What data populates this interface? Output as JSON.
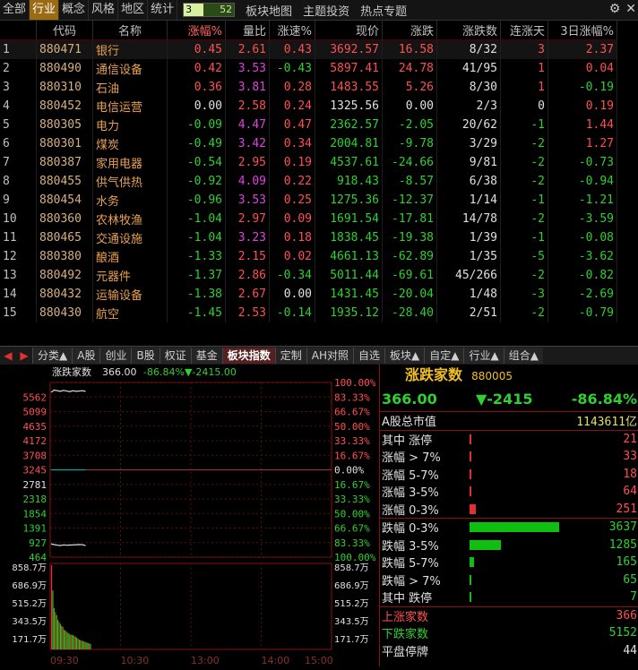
{
  "top_tabs": [
    "全部",
    "行业",
    "概念",
    "风格",
    "地区",
    "统计"
  ],
  "active_top_tab": "行业",
  "pager": {
    "current": "3",
    "total": "52"
  },
  "top_links": [
    "板块地图",
    "主题投资",
    "热点专题"
  ],
  "columns": [
    "",
    "代码",
    "名称",
    "涨幅%",
    "量比",
    "涨速%",
    "现价",
    "涨跌",
    "涨跌数",
    "连涨天",
    "3日涨幅%"
  ],
  "rows": [
    {
      "idx": "1",
      "code": "880471",
      "name": "银行",
      "pct": "0.45",
      "vr": "2.61",
      "spd": "0.43",
      "price": "3692.57",
      "chg": "16.58",
      "ud": "8/32",
      "days": "3",
      "d3": "2.37",
      "pc": "red",
      "vc": "red",
      "sc": "red",
      "dc": "red",
      "d3c": "red"
    },
    {
      "idx": "2",
      "code": "880490",
      "name": "通信设备",
      "pct": "0.42",
      "vr": "3.53",
      "spd": "-0.43",
      "price": "5897.41",
      "chg": "24.78",
      "ud": "41/95",
      "days": "1",
      "d3": "0.04",
      "pc": "red",
      "vc": "purple",
      "sc": "green",
      "dc": "red",
      "d3c": "red"
    },
    {
      "idx": "3",
      "code": "880310",
      "name": "石油",
      "pct": "0.36",
      "vr": "3.81",
      "spd": "0.28",
      "price": "1483.55",
      "chg": "5.26",
      "ud": "8/30",
      "days": "1",
      "d3": "-0.19",
      "pc": "red",
      "vc": "purple",
      "sc": "red",
      "dc": "red",
      "d3c": "green"
    },
    {
      "idx": "4",
      "code": "880452",
      "name": "电信运营",
      "pct": "0.00",
      "vr": "2.58",
      "spd": "0.24",
      "price": "1325.56",
      "chg": "0.00",
      "ud": "2/3",
      "days": "0",
      "d3": "0.19",
      "pc": "white",
      "vc": "red",
      "sc": "red",
      "dc": "white",
      "d3c": "red"
    },
    {
      "idx": "5",
      "code": "880305",
      "name": "电力",
      "pct": "-0.09",
      "vr": "4.47",
      "spd": "0.47",
      "price": "2362.57",
      "chg": "-2.05",
      "ud": "20/62",
      "days": "-1",
      "d3": "1.44",
      "pc": "green",
      "vc": "purple",
      "sc": "red",
      "dc": "green",
      "d3c": "red"
    },
    {
      "idx": "6",
      "code": "880301",
      "name": "煤炭",
      "pct": "-0.49",
      "vr": "3.42",
      "spd": "0.34",
      "price": "2004.81",
      "chg": "-9.78",
      "ud": "3/29",
      "days": "-2",
      "d3": "1.27",
      "pc": "green",
      "vc": "purple",
      "sc": "red",
      "dc": "green",
      "d3c": "red"
    },
    {
      "idx": "7",
      "code": "880387",
      "name": "家用电器",
      "pct": "-0.54",
      "vr": "2.95",
      "spd": "0.19",
      "price": "4537.61",
      "chg": "-24.66",
      "ud": "9/81",
      "days": "-2",
      "d3": "-0.73",
      "pc": "green",
      "vc": "red",
      "sc": "red",
      "dc": "green",
      "d3c": "green"
    },
    {
      "idx": "8",
      "code": "880455",
      "name": "供气供热",
      "pct": "-0.92",
      "vr": "4.09",
      "spd": "0.22",
      "price": "918.43",
      "chg": "-8.57",
      "ud": "6/38",
      "days": "-2",
      "d3": "-0.94",
      "pc": "green",
      "vc": "purple",
      "sc": "red",
      "dc": "green",
      "d3c": "green"
    },
    {
      "idx": "9",
      "code": "880454",
      "name": "水务",
      "pct": "-0.96",
      "vr": "3.53",
      "spd": "0.25",
      "price": "1275.36",
      "chg": "-12.37",
      "ud": "1/14",
      "days": "-1",
      "d3": "-1.21",
      "pc": "green",
      "vc": "purple",
      "sc": "red",
      "dc": "green",
      "d3c": "green"
    },
    {
      "idx": "10",
      "code": "880360",
      "name": "农林牧渔",
      "pct": "-1.04",
      "vr": "2.97",
      "spd": "0.09",
      "price": "1691.54",
      "chg": "-17.81",
      "ud": "14/78",
      "days": "-2",
      "d3": "-3.59",
      "pc": "green",
      "vc": "red",
      "sc": "red",
      "dc": "green",
      "d3c": "green"
    },
    {
      "idx": "11",
      "code": "880465",
      "name": "交通设施",
      "pct": "-1.04",
      "vr": "3.23",
      "spd": "0.18",
      "price": "1838.45",
      "chg": "-19.38",
      "ud": "1/39",
      "days": "-1",
      "d3": "-0.08",
      "pc": "green",
      "vc": "purple",
      "sc": "red",
      "dc": "green",
      "d3c": "green"
    },
    {
      "idx": "12",
      "code": "880380",
      "name": "酿酒",
      "pct": "-1.33",
      "vr": "2.15",
      "spd": "0.02",
      "price": "4661.13",
      "chg": "-62.89",
      "ud": "1/35",
      "days": "-5",
      "d3": "-3.62",
      "pc": "green",
      "vc": "red",
      "sc": "red",
      "dc": "green",
      "d3c": "green"
    },
    {
      "idx": "13",
      "code": "880492",
      "name": "元器件",
      "pct": "-1.37",
      "vr": "2.86",
      "spd": "-0.34",
      "price": "5011.44",
      "chg": "-69.61",
      "ud": "45/266",
      "days": "-2",
      "d3": "-0.82",
      "pc": "green",
      "vc": "red",
      "sc": "green",
      "dc": "green",
      "d3c": "green"
    },
    {
      "idx": "14",
      "code": "880432",
      "name": "运输设备",
      "pct": "-1.38",
      "vr": "2.67",
      "spd": "0.00",
      "price": "1431.45",
      "chg": "-20.04",
      "ud": "1/48",
      "days": "-3",
      "d3": "-2.69",
      "pc": "green",
      "vc": "red",
      "sc": "white",
      "dc": "green",
      "d3c": "green"
    },
    {
      "idx": "15",
      "code": "880430",
      "name": "航空",
      "pct": "-1.45",
      "vr": "2.53",
      "spd": "-0.14",
      "price": "1935.12",
      "chg": "-28.40",
      "ud": "2/51",
      "days": "-2",
      "d3": "-0.79",
      "pc": "green",
      "vc": "red",
      "sc": "green",
      "dc": "green",
      "d3c": "green"
    }
  ],
  "sheet_tabs": [
    "分类▲",
    "A股",
    "创业",
    "B股",
    "权证",
    "基金",
    "板块指数",
    "定制",
    "AH对照",
    "自选",
    "板块▲",
    "自定▲",
    "行业▲",
    "组合▲"
  ],
  "active_sheet_tab": "板块指数",
  "chart_header": {
    "name": "涨跌家数",
    "value": "366.00",
    "pct": "-86.84%",
    "chg": "▼-2415.00"
  },
  "chart_data": {
    "type": "line",
    "x_ticks": [
      "09:30",
      "10:30",
      "13:00",
      "14:00",
      "15:00"
    ],
    "left_ticks": [
      "5562",
      "5099",
      "4635",
      "4172",
      "3708",
      "3245",
      "2781",
      "2318",
      "1854",
      "1391",
      "927",
      "464"
    ],
    "right_ticks": [
      "100.00%",
      "83.33%",
      "66.67%",
      "50.00%",
      "33.33%",
      "16.67%",
      "0.00%",
      "16.67%",
      "33.33%",
      "50.00%",
      "66.67%",
      "83.33%",
      "100.00%"
    ],
    "volume_ticks": [
      "858.7万",
      "686.9万",
      "515.2万",
      "343.5万",
      "171.7万"
    ],
    "series": [
      {
        "values": [
          5250,
          5320,
          5300,
          5280,
          5310,
          5290,
          5270,
          5300,
          5280,
          5290,
          5300,
          5280
        ]
      },
      {
        "values": [
          2781,
          2781,
          2781,
          2781,
          2781,
          2781,
          2781,
          2781,
          2781,
          2781,
          2781,
          2781
        ]
      },
      {
        "values": [
          420,
          400,
          380,
          370,
          390,
          380,
          385,
          390,
          395,
          400,
          398,
          366
        ]
      }
    ],
    "ylim": [
      0,
      5562
    ],
    "volume_values": [
      858,
      600,
      420,
      380,
      350,
      300,
      280,
      260,
      240,
      230,
      200,
      190,
      180,
      170,
      160,
      150,
      150,
      145,
      140,
      130,
      120,
      110,
      100,
      95,
      90,
      85,
      80,
      75,
      70,
      65,
      60,
      55
    ]
  },
  "right_panel": {
    "title": "涨跌家数",
    "code": "880005",
    "value": "366.00",
    "chg": "▼-2415",
    "pct": "-86.84%",
    "mktcap_label": "A股总市值",
    "mktcap_value": "1143611亿",
    "up_rows": [
      {
        "label": "其中 涨停",
        "value": "21",
        "bar": 0.006
      },
      {
        "label": "涨幅 > 7%",
        "value": "33",
        "bar": 0.009
      },
      {
        "label": "涨幅 5-7%",
        "value": "18",
        "bar": 0.005
      },
      {
        "label": "涨幅 3-5%",
        "value": "64",
        "bar": 0.018
      },
      {
        "label": "涨幅 0-3%",
        "value": "251",
        "bar": 0.069
      }
    ],
    "down_rows": [
      {
        "label": "跌幅 0-3%",
        "value": "3637",
        "bar": 1.0
      },
      {
        "label": "跌幅 3-5%",
        "value": "1285",
        "bar": 0.353
      },
      {
        "label": "跌幅 5-7%",
        "value": "165",
        "bar": 0.045
      },
      {
        "label": "跌幅 > 7%",
        "value": "65",
        "bar": 0.018
      },
      {
        "label": "其中 跌停",
        "value": "7",
        "bar": 0.002
      }
    ],
    "summary": [
      {
        "label": "上涨家数",
        "value": "366"
      },
      {
        "label": "下跌家数",
        "value": "5152"
      },
      {
        "label": "平盘停牌",
        "value": "44"
      }
    ]
  }
}
